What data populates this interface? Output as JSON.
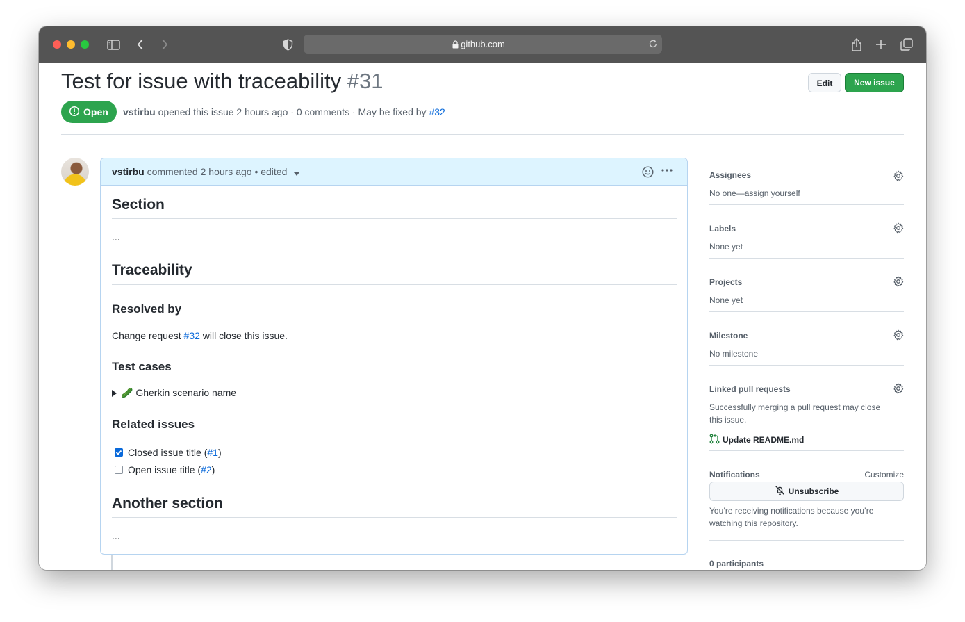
{
  "browser": {
    "url": "github.com"
  },
  "issue": {
    "title": "Test for issue with traceability",
    "number": "#31",
    "edit_label": "Edit",
    "new_issue_label": "New issue",
    "state": "Open",
    "author": "vstirbu",
    "meta_text": "opened this issue 2 hours ago · 0 comments · May be fixed by",
    "fixed_by": "#32"
  },
  "comment": {
    "author": "vstirbu",
    "header_text": "commented 2 hours ago • edited",
    "sections": {
      "section_heading": "Section",
      "section_body": "...",
      "traceability_heading": "Traceability",
      "resolved_by_heading": "Resolved by",
      "resolved_text_before": "Change request",
      "resolved_link": "#32",
      "resolved_text_after": "will close this issue.",
      "test_cases_heading": "Test cases",
      "gherkin_summary": "🥒 Gherkin scenario name",
      "related_issues_heading": "Related issues",
      "tasks": [
        {
          "label_before": "Closed issue title (",
          "link": "#1",
          "label_after": ")",
          "checked": true
        },
        {
          "label_before": "Open issue title (",
          "link": "#2",
          "label_after": ")",
          "checked": false
        }
      ],
      "another_heading": "Another section",
      "another_body": "..."
    }
  },
  "sidebar": {
    "assignees": {
      "heading": "Assignees",
      "value": "No one—assign yourself"
    },
    "labels": {
      "heading": "Labels",
      "value": "None yet"
    },
    "projects": {
      "heading": "Projects",
      "value": "None yet"
    },
    "milestone": {
      "heading": "Milestone",
      "value": "No milestone"
    },
    "linked_prs": {
      "heading": "Linked pull requests",
      "value_line1": "Successfully merging a pull request may close",
      "value_line2": "this issue.",
      "pr_title": "Update README.md"
    },
    "notifications": {
      "heading": "Notifications",
      "customize": "Customize",
      "unsubscribe": "Unsubscribe",
      "note_line1": "You’re receiving notifications because you’re",
      "note_line2": "watching this repository."
    },
    "participants": "0 participants"
  },
  "colors": {
    "open_green": "#2da44e",
    "link_blue": "#0969da",
    "header_blue": "#ddf4ff"
  }
}
